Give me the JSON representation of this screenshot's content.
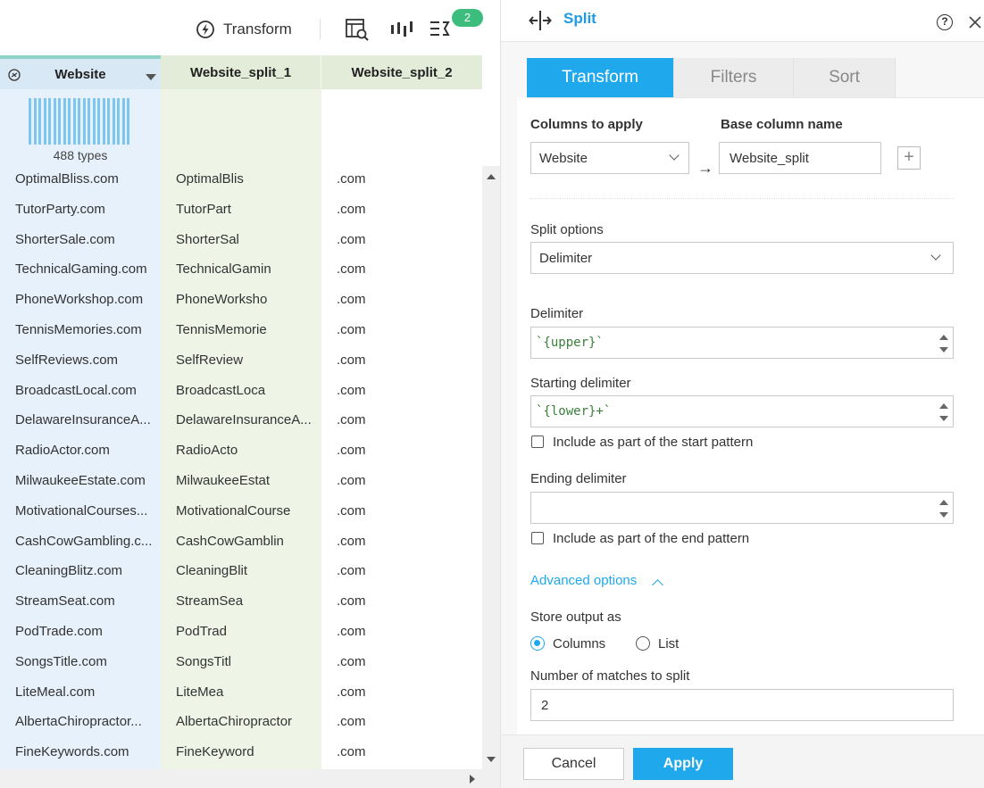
{
  "toolbar": {
    "transform_label": "Transform",
    "badge_count": "2"
  },
  "grid": {
    "columns": [
      "Website",
      "Website_split_1",
      "Website_split_2"
    ],
    "types_label": "488 types",
    "rows": [
      [
        "OptimalBliss.com",
        "OptimalBlis",
        ".com"
      ],
      [
        "TutorParty.com",
        "TutorPart",
        ".com"
      ],
      [
        "ShorterSale.com",
        "ShorterSal",
        ".com"
      ],
      [
        "TechnicalGaming.com",
        "TechnicalGamin",
        ".com"
      ],
      [
        "PhoneWorkshop.com",
        "PhoneWorksho",
        ".com"
      ],
      [
        "TennisMemories.com",
        "TennisMemorie",
        ".com"
      ],
      [
        "SelfReviews.com",
        "SelfReview",
        ".com"
      ],
      [
        "BroadcastLocal.com",
        "BroadcastLoca",
        ".com"
      ],
      [
        "DelawareInsuranceA...",
        "DelawareInsuranceA...",
        ".com"
      ],
      [
        "RadioActor.com",
        "RadioActo",
        ".com"
      ],
      [
        "MilwaukeeEstate.com",
        "MilwaukeeEstat",
        ".com"
      ],
      [
        "MotivationalCourses...",
        "MotivationalCourse",
        ".com"
      ],
      [
        "CashCowGambling.c...",
        "CashCowGamblin",
        ".com"
      ],
      [
        "CleaningBlitz.com",
        "CleaningBlit",
        ".com"
      ],
      [
        "StreamSeat.com",
        "StreamSea",
        ".com"
      ],
      [
        "PodTrade.com",
        "PodTrad",
        ".com"
      ],
      [
        "SongsTitle.com",
        "SongsTitl",
        ".com"
      ],
      [
        "LiteMeal.com",
        "LiteMea",
        ".com"
      ],
      [
        "AlbertaChiropractor...",
        "AlbertaChiropractor",
        ".com"
      ],
      [
        "FineKeywords.com",
        "FineKeyword",
        ".com"
      ]
    ]
  },
  "panel": {
    "title": "Split",
    "tabs": [
      "Transform",
      "Filters",
      "Sort"
    ],
    "columns_to_apply_label": "Columns to apply",
    "columns_to_apply_value": "Website",
    "base_column_label": "Base column name",
    "base_column_value": "Website_split",
    "split_options_label": "Split options",
    "split_options_value": "Delimiter",
    "delimiter_label": "Delimiter",
    "delimiter_value": "`{upper}`",
    "starting_delimiter_label": "Starting delimiter",
    "starting_delimiter_value": "`{lower}+`",
    "include_start_label": "Include as part of the start pattern",
    "ending_delimiter_label": "Ending delimiter",
    "ending_delimiter_value": "",
    "include_end_label": "Include as part of the end pattern",
    "advanced_label": "Advanced options",
    "store_output_label": "Store output as",
    "store_output_options": [
      "Columns",
      "List"
    ],
    "store_output_selected": "Columns",
    "matches_label": "Number of matches to split",
    "matches_value": "2",
    "cancel_label": "Cancel",
    "apply_label": "Apply"
  },
  "colors": {
    "accent": "#1fa8ec",
    "badge": "#3dbd7d",
    "website_col_bg": "#e6f1fb",
    "split_col_bg": "#eef4e6",
    "histogram_bar": "#7cc6ef"
  }
}
